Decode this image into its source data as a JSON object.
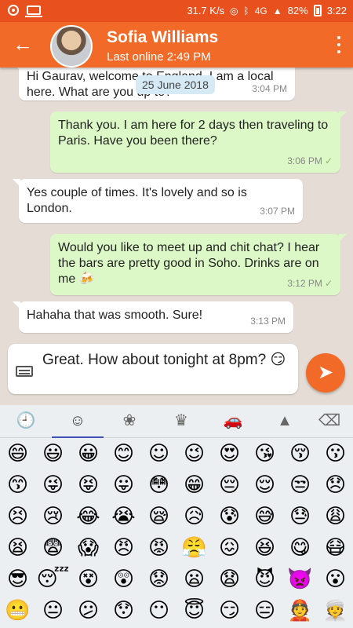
{
  "status_bar": {
    "speed": "31.7 K/s",
    "network": "4G",
    "battery": "82%",
    "time": "3:22"
  },
  "header": {
    "contact_name": "Sofia Williams",
    "last_online": "Last online 2:49 PM",
    "avatar_icon": "profile-photo",
    "back_icon": "arrow-left",
    "more_icon": "vertical-dots"
  },
  "chat": {
    "date_chip": "25 June 2018",
    "messages": [
      {
        "direction": "incoming",
        "text": "Hi Gaurav, welcome to England, I am a local here. What are you up to?",
        "time": "3:04 PM"
      },
      {
        "direction": "outgoing",
        "text": "Thank you. I am here for 2 days then traveling to Paris. Have you been there?",
        "time": "3:06 PM",
        "tick": "✓"
      },
      {
        "direction": "incoming",
        "text": "Yes couple of times. It's lovely and so is London.",
        "time": "3:07 PM"
      },
      {
        "direction": "outgoing",
        "text": "Would you like to meet up and chit chat? I hear the bars are pretty good in Soho. Drinks are on me 🍻",
        "time": "3:12 PM",
        "tick": "✓"
      },
      {
        "direction": "incoming",
        "text": "Hahaha that was smooth. Sure!",
        "time": "3:13 PM"
      }
    ]
  },
  "composer": {
    "text": "Great. How about tonight at 8pm? 😏",
    "keyboard_icon": "keyboard",
    "send_icon": "send-arrow"
  },
  "emoji_keyboard": {
    "tabs": [
      "🕘",
      "☺",
      "❀",
      "♛",
      "🚗",
      "▲",
      "⌫"
    ],
    "active_tab": 1,
    "emojis": [
      "😄",
      "😃",
      "😀",
      "😊",
      "☺",
      "😉",
      "😍",
      "😘",
      "😚",
      "😗",
      "😙",
      "😜",
      "😝",
      "😛",
      "😳",
      "😁",
      "😔",
      "😌",
      "😒",
      "😞",
      "😣",
      "😢",
      "😂",
      "😭",
      "😪",
      "😥",
      "😰",
      "😅",
      "😓",
      "😩",
      "😫",
      "😨",
      "😱",
      "😠",
      "😡",
      "😤",
      "😖",
      "😆",
      "😋",
      "😷",
      "😎",
      "😴",
      "😵",
      "😲",
      "😟",
      "😦",
      "😧",
      "😈",
      "👿",
      "😮",
      "😬",
      "😐",
      "😕",
      "😯",
      "😶",
      "😇",
      "😏",
      "😑",
      "👲",
      "👳"
    ]
  },
  "colors": {
    "status_bar": "#e8501e",
    "app_bar": "#f26a27",
    "outgoing_bubble": "#dcf8c6",
    "incoming_bubble": "#ffffff"
  }
}
